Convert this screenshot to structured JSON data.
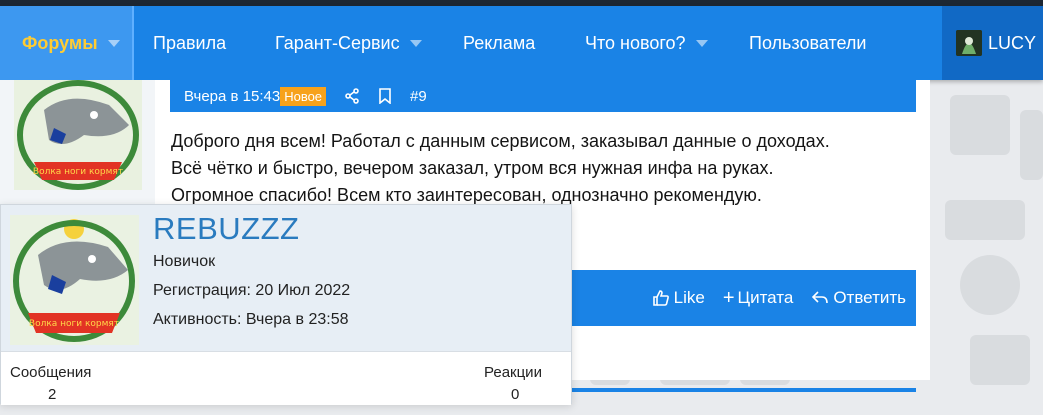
{
  "nav": {
    "items": [
      {
        "label": "Форумы",
        "active": true,
        "has_caret": true
      },
      {
        "label": "Правила",
        "has_caret": false
      },
      {
        "label": "Гарант-Сервис",
        "has_caret": true
      },
      {
        "label": "Реклама",
        "has_caret": false
      },
      {
        "label": "Что нового?",
        "has_caret": true
      },
      {
        "label": "Пользователи",
        "has_caret": false
      }
    ],
    "user_name": "LUCY"
  },
  "post": {
    "timestamp": "Вчера в 15:43",
    "badge": "Новое",
    "number": "#9",
    "body_lines": [
      "Доброго дня всем! Работал с данным сервисом, заказывал данные о доходах.",
      "Всё чётко и быстро, вечером заказал, утром вся нужная инфа на руках.",
      "Огромное спасибо! Всем кто заинтересован, однозначно рекомендую."
    ],
    "actions": {
      "like": "Like",
      "quote": "Цитата",
      "reply": "Ответить"
    }
  },
  "member": {
    "name": "REBUZZZ",
    "title": "Новичок",
    "registration": "Регистрация: 20 Июл 2022",
    "activity": "Активность: Вчера в 23:58",
    "stats": {
      "messages_label": "Сообщения",
      "messages_value": "2",
      "reactions_label": "Реакции",
      "reactions_value": "0"
    }
  },
  "avatar_caption": "Волка ноги кормят",
  "colors": {
    "nav_bg": "#1a83e6",
    "nav_active_text": "#ffcc33",
    "badge_new": "#f7a21b",
    "member_name": "#2a7bbf"
  }
}
